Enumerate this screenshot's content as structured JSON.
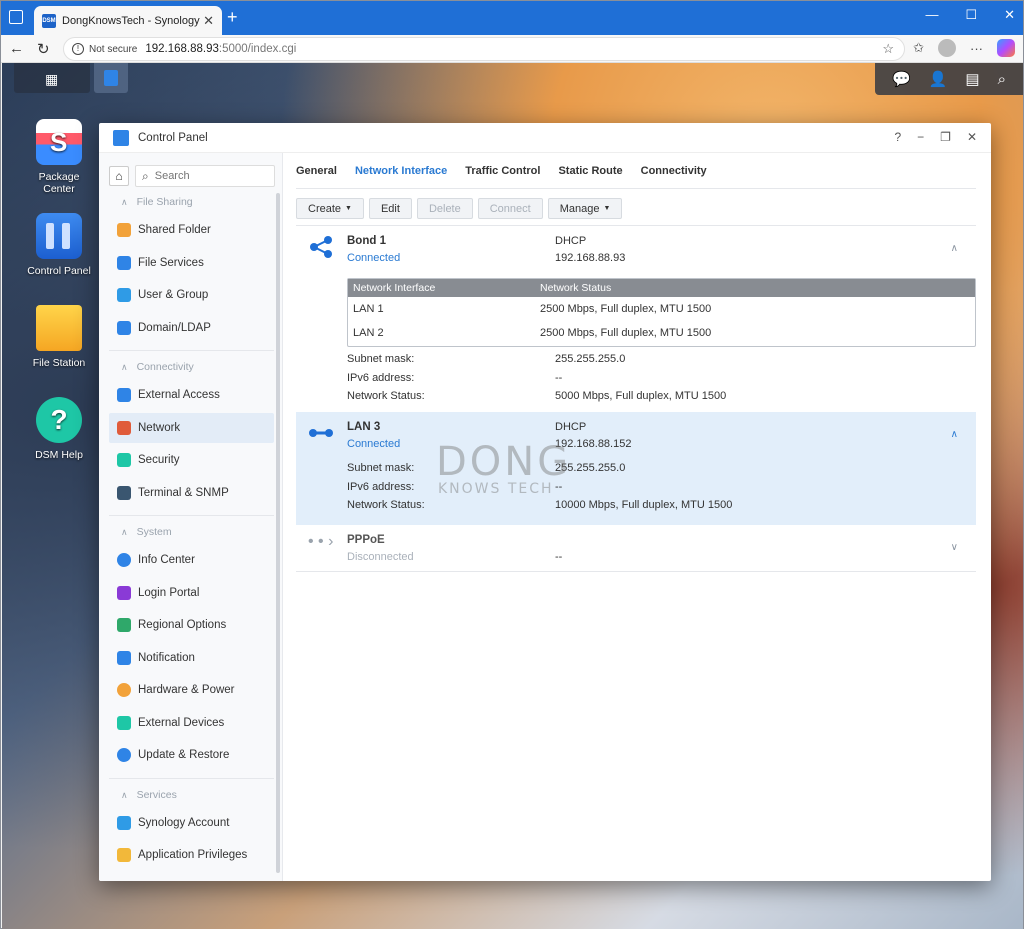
{
  "browser": {
    "tab_title": "DongKnowsTech - Synology NAS",
    "favicon_text": "DSM",
    "address_warning": "Not secure",
    "url_host": "192.168.88.93",
    "url_path": ":5000/index.cgi"
  },
  "desktop": {
    "icons": [
      {
        "label_line1": "Package",
        "label_line2": "Center"
      },
      {
        "label": "Control Panel"
      },
      {
        "label": "File Station"
      },
      {
        "label": "DSM Help"
      }
    ]
  },
  "window": {
    "title": "Control Panel",
    "help": "?",
    "minimize": "−",
    "maximize": "❐",
    "close": "✕"
  },
  "sidebar": {
    "search_placeholder": "Search",
    "sections": [
      {
        "label": "File Sharing"
      },
      {
        "label": "Connectivity"
      },
      {
        "label": "System"
      },
      {
        "label": "Services"
      }
    ],
    "items": [
      {
        "label": "Shared Folder",
        "color": "#f2a23a"
      },
      {
        "label": "File Services",
        "color": "#2f84e6"
      },
      {
        "label": "User & Group",
        "color": "#2f9be6"
      },
      {
        "label": "Domain/LDAP",
        "color": "#2f84e6"
      },
      {
        "label": "External Access",
        "color": "#2f84e6"
      },
      {
        "label": "Network",
        "color": "#e05b3a"
      },
      {
        "label": "Security",
        "color": "#1ec7a6"
      },
      {
        "label": "Terminal & SNMP",
        "color": "#3a5670"
      },
      {
        "label": "Info Center",
        "color": "#2f84e6"
      },
      {
        "label": "Login Portal",
        "color": "#8a3ad6"
      },
      {
        "label": "Regional Options",
        "color": "#2fa86a"
      },
      {
        "label": "Notification",
        "color": "#2f84e6"
      },
      {
        "label": "Hardware & Power",
        "color": "#f2a23a"
      },
      {
        "label": "External Devices",
        "color": "#1ec7a6"
      },
      {
        "label": "Update & Restore",
        "color": "#2f84e6"
      },
      {
        "label": "Synology Account",
        "color": "#2f9be6"
      },
      {
        "label": "Application Privileges",
        "color": "#f2b83a"
      }
    ],
    "active_item": "Network"
  },
  "tabs": [
    "General",
    "Network Interface",
    "Traffic Control",
    "Static Route",
    "Connectivity"
  ],
  "active_tab": "Network Interface",
  "actions": {
    "create": "Create",
    "edit": "Edit",
    "delete": "Delete",
    "connect": "Connect",
    "manage": "Manage"
  },
  "interfaces": {
    "bond": {
      "name": "Bond 1",
      "status": "Connected",
      "type": "DHCP",
      "ip": "192.168.88.93",
      "table_headers": [
        "Network Interface",
        "Network Status"
      ],
      "members": [
        {
          "iface": "LAN 1",
          "status": "2500 Mbps, Full duplex, MTU 1500"
        },
        {
          "iface": "LAN 2",
          "status": "2500 Mbps, Full duplex, MTU 1500"
        }
      ],
      "subnet_label": "Subnet mask:",
      "subnet": "255.255.255.0",
      "ipv6_label": "IPv6 address:",
      "ipv6": "--",
      "net_status_label": "Network Status:",
      "net_status": "5000 Mbps, Full duplex, MTU 1500"
    },
    "lan3": {
      "name": "LAN 3",
      "status": "Connected",
      "type": "DHCP",
      "ip": "192.168.88.152",
      "subnet_label": "Subnet mask:",
      "subnet": "255.255.255.0",
      "ipv6_label": "IPv6 address:",
      "ipv6": "--",
      "net_status_label": "Network Status:",
      "net_status": "10000 Mbps, Full duplex, MTU 1500"
    },
    "pppoe": {
      "name": "PPPoE",
      "status": "Disconnected",
      "ip": "--"
    }
  },
  "watermark": {
    "line1": "DONG",
    "line2": "KNOWS TECH"
  }
}
